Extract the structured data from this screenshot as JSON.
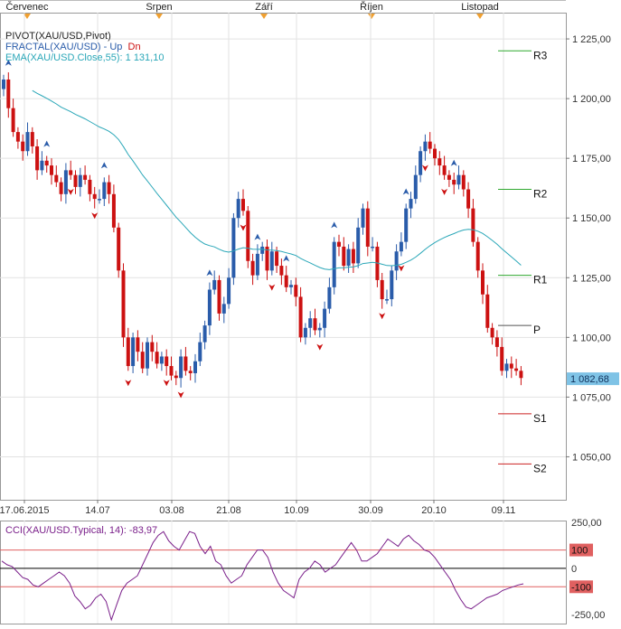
{
  "symbol": "XAU/USD",
  "months": [
    "Červenec",
    "Srpen",
    "Září",
    "Říjen",
    "Listopad"
  ],
  "legend": {
    "pivot": "PIVOT(XAU/USD,Pivot)",
    "fractal": "FRACTAL(XAU/USD)",
    "fractal_sep": " - ",
    "fractal_up": "Up",
    "fractal_dn": "Dn",
    "ema": "EMA(XAU/USD.Close,55): 1 131,10",
    "cci": "CCI(XAU/USD.Typical, 14): -83,97"
  },
  "colors": {
    "up": "#2a5caa",
    "down": "#cc1111",
    "ema": "#2aa7b8",
    "pivot_line": "#2fa82f",
    "support_line": "#cc2222",
    "cci_line": "#7a1f8a",
    "cci_band": "#e06060",
    "price_tag_bg": "#7fc3e6",
    "month_marker": "#f0a030"
  },
  "chart_data": [
    {
      "type": "candlestick",
      "x_tick_labels": [
        "17.06.2015",
        "14.07",
        "03.08",
        "21.08",
        "10.09",
        "30.09",
        "20.10",
        "09.11"
      ],
      "y_tick_labels": [
        "1 225,00",
        "1 200,00",
        "1 175,00",
        "1 150,00",
        "1 125,00",
        "1 100,00",
        "1 075,00",
        "1 050,00"
      ],
      "y_ticks": [
        1225,
        1200,
        1175,
        1150,
        1125,
        1100,
        1075,
        1050
      ],
      "ylim": [
        1032,
        1236
      ],
      "last_price": 1082.68,
      "last_price_label": "1 082,68",
      "close": [
        1208,
        1196,
        1186,
        1182,
        1178,
        1186,
        1180,
        1170,
        1174,
        1172,
        1168,
        1165,
        1160,
        1170,
        1168,
        1163,
        1168,
        1166,
        1160,
        1158,
        1158,
        1165,
        1160,
        1146,
        1128,
        1100,
        1088,
        1100,
        1094,
        1087,
        1098,
        1094,
        1089,
        1092,
        1088,
        1084,
        1083,
        1092,
        1086,
        1085,
        1090,
        1098,
        1105,
        1120,
        1124,
        1110,
        1114,
        1125,
        1150,
        1158,
        1153,
        1132,
        1126,
        1135,
        1138,
        1128,
        1136,
        1130,
        1126,
        1121,
        1122,
        1117,
        1100,
        1104,
        1108,
        1103,
        1104,
        1112,
        1121,
        1140,
        1138,
        1130,
        1137,
        1131,
        1146,
        1154,
        1138,
        1138,
        1124,
        1116,
        1116,
        1128,
        1136,
        1140,
        1154,
        1158,
        1168,
        1178,
        1182,
        1179,
        1175,
        1172,
        1168,
        1166,
        1164,
        1168,
        1162,
        1154,
        1140,
        1128,
        1118,
        1104,
        1100,
        1096,
        1086,
        1089,
        1087,
        1086,
        1083
      ],
      "fractals_up": [
        1,
        9,
        21,
        43,
        53,
        59,
        69,
        84,
        94
      ],
      "fractals_down": [
        14,
        19,
        26,
        34,
        37,
        50,
        56,
        66,
        79,
        83,
        88,
        92
      ],
      "ema_period": 55,
      "ema_last": 1131.1,
      "pivot_levels": [
        {
          "label": "R3",
          "value": 1220
        },
        {
          "label": "R2",
          "value": 1162
        },
        {
          "label": "R1",
          "value": 1126
        },
        {
          "label": "P",
          "value": 1105
        },
        {
          "label": "S1",
          "value": 1068
        },
        {
          "label": "S2",
          "value": 1047
        }
      ]
    },
    {
      "type": "line",
      "name": "CCI(XAU/USD.Typical, 14)",
      "ylim": [
        -300,
        260
      ],
      "y_ticks": [
        250,
        100,
        0,
        -100,
        -250
      ],
      "y_tick_labels": [
        "250,00",
        "100",
        "0",
        "-100",
        "-250,00"
      ],
      "band_levels": [
        100,
        -100
      ],
      "last_value": -83.97,
      "values": [
        40,
        20,
        10,
        -20,
        -50,
        -60,
        -90,
        -100,
        -80,
        -60,
        -40,
        -20,
        -40,
        -80,
        -150,
        -180,
        -220,
        -200,
        -160,
        -140,
        -180,
        -280,
        -200,
        -120,
        -80,
        -60,
        -40,
        20,
        80,
        140,
        180,
        200,
        150,
        120,
        100,
        150,
        200,
        190,
        120,
        80,
        120,
        40,
        20,
        -40,
        -80,
        -60,
        -40,
        20,
        60,
        100,
        100,
        60,
        -20,
        -80,
        -120,
        -140,
        -160,
        -60,
        -20,
        0,
        40,
        20,
        -20,
        0,
        20,
        60,
        100,
        140,
        100,
        40,
        40,
        60,
        80,
        120,
        160,
        140,
        120,
        160,
        180,
        150,
        130,
        100,
        90,
        60,
        20,
        -20,
        -60,
        -120,
        -170,
        -210,
        -220,
        -200,
        -180,
        -160,
        -150,
        -140,
        -120,
        -110,
        -100,
        -90,
        -84
      ]
    }
  ]
}
